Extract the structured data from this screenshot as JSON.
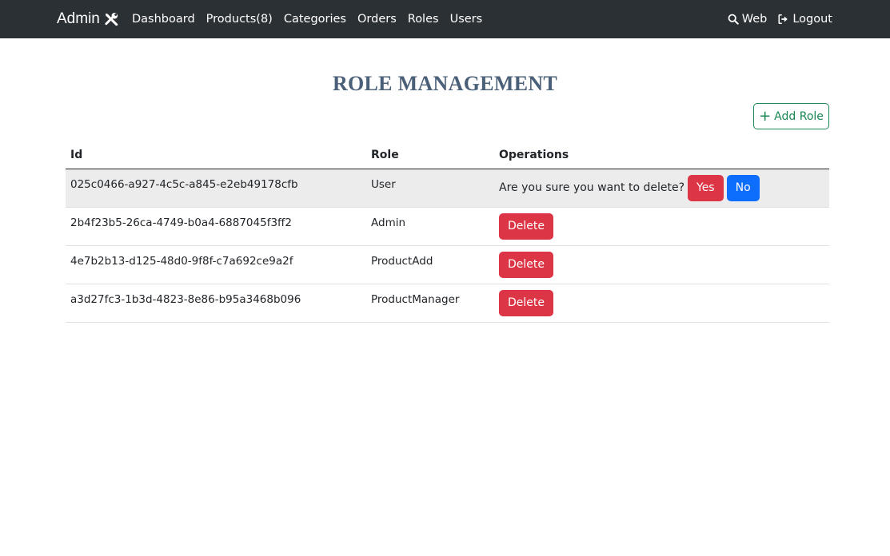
{
  "navbar": {
    "brand": "Admin",
    "links": [
      "Dashboard",
      "Products(8)",
      "Categories",
      "Orders",
      "Roles",
      "Users"
    ],
    "web_label": "Web",
    "logout_label": "Logout"
  },
  "page": {
    "title": "ROLE MANAGEMENT",
    "add_button_label": "Add Role"
  },
  "table": {
    "headers": [
      "Id",
      "Role",
      "Operations"
    ],
    "rows": [
      {
        "id": "025c0466-a927-4c5c-a845-e2eb49178cfb",
        "role": "User",
        "confirming": true
      },
      {
        "id": "2b4f23b5-26ca-4749-b0a4-6887045f3ff2",
        "role": "Admin",
        "confirming": false
      },
      {
        "id": "4e7b2b13-d125-48d0-9f8f-c7a692ce9a2f",
        "role": "ProductAdd",
        "confirming": false
      },
      {
        "id": "a3d27fc3-1b3d-4823-8e86-b95a3468b096",
        "role": "ProductManager",
        "confirming": false
      }
    ],
    "confirm_text": "Are you sure you want to delete?",
    "yes_label": "Yes",
    "no_label": "No",
    "delete_label": "Delete"
  },
  "colors": {
    "navbar_bg": "#2b3035",
    "danger": "#dc3545",
    "primary": "#0d6efd",
    "success": "#198754"
  }
}
